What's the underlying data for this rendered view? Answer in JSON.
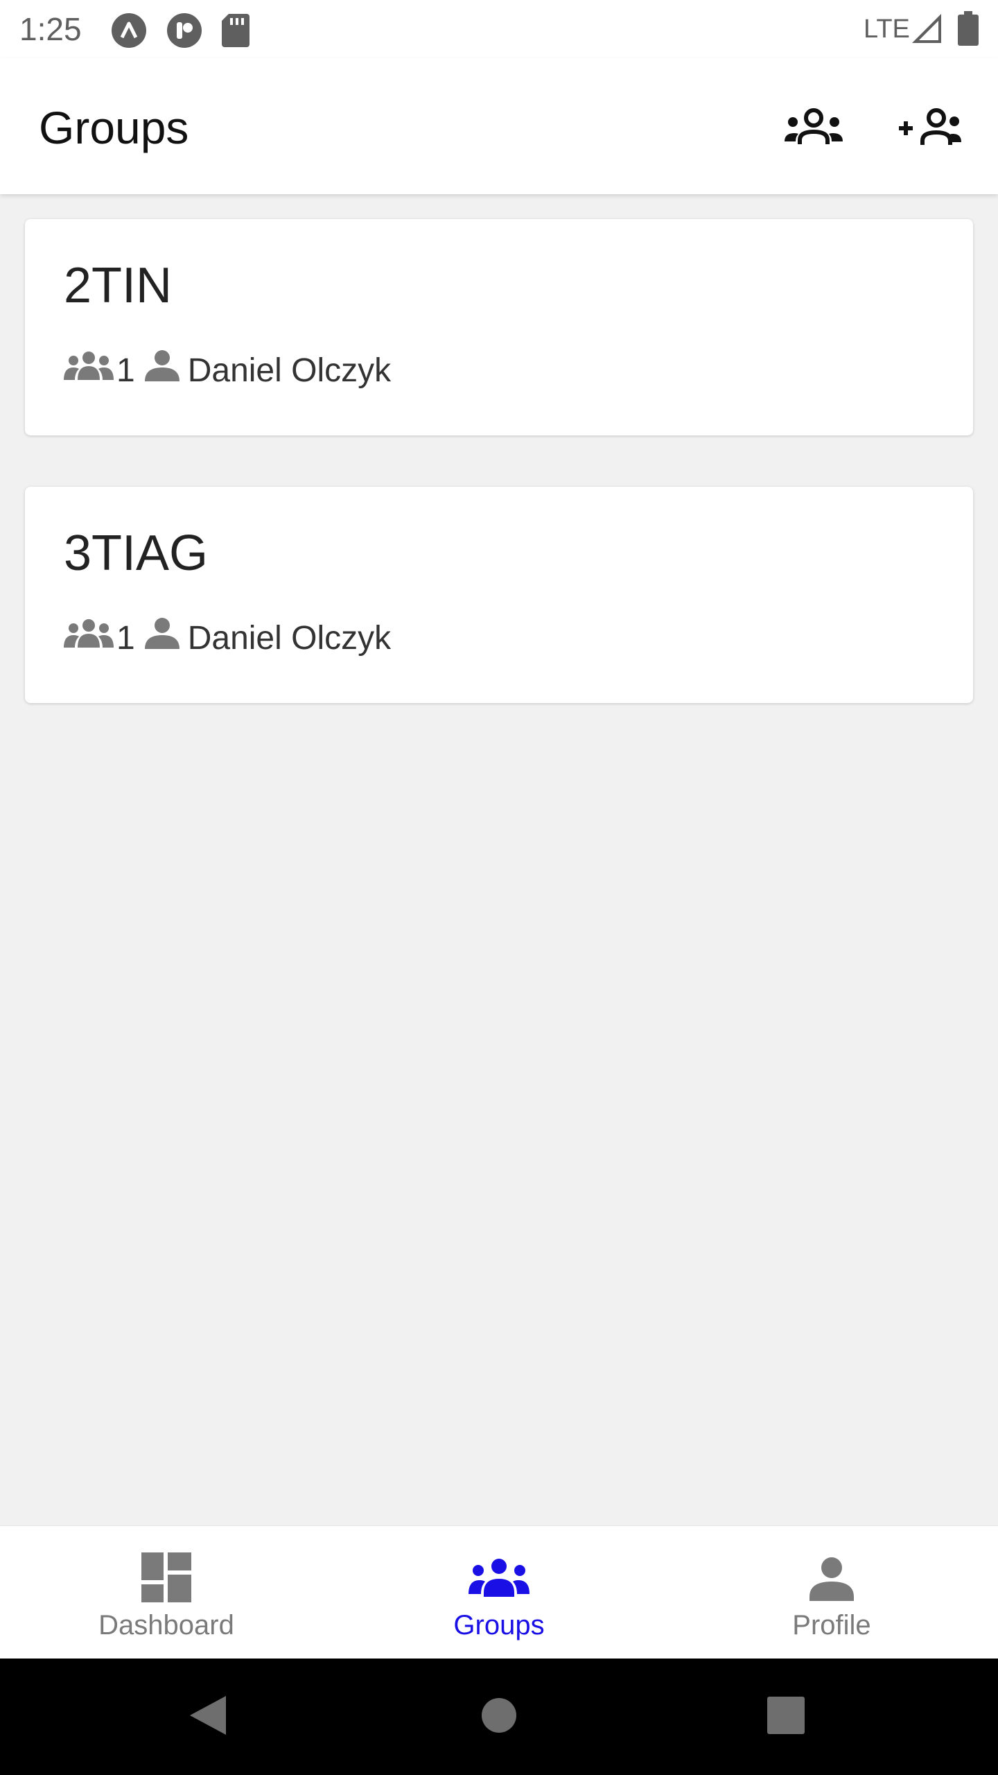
{
  "status_bar": {
    "time": "1:25",
    "network": "LTE",
    "icons": [
      "app-circle-icon",
      "app-circle-icon",
      "sd-card-icon",
      "signal-icon",
      "battery-icon"
    ]
  },
  "app_bar": {
    "title": "Groups",
    "actions": [
      "groups-icon",
      "add-group-icon"
    ]
  },
  "groups": [
    {
      "name": "2TIN",
      "member_count": "1",
      "owner": "Daniel Olczyk"
    },
    {
      "name": "3TIAG",
      "member_count": "1",
      "owner": "Daniel Olczyk"
    }
  ],
  "bottom_nav": {
    "items": [
      {
        "label": "Dashboard",
        "icon": "dashboard-icon",
        "active": false
      },
      {
        "label": "Groups",
        "icon": "groups-icon",
        "active": true
      },
      {
        "label": "Profile",
        "icon": "person-icon",
        "active": false
      }
    ]
  },
  "colors": {
    "accent": "#1a10e6",
    "inactive": "#7a7a7a",
    "background": "#f1f1f1"
  }
}
